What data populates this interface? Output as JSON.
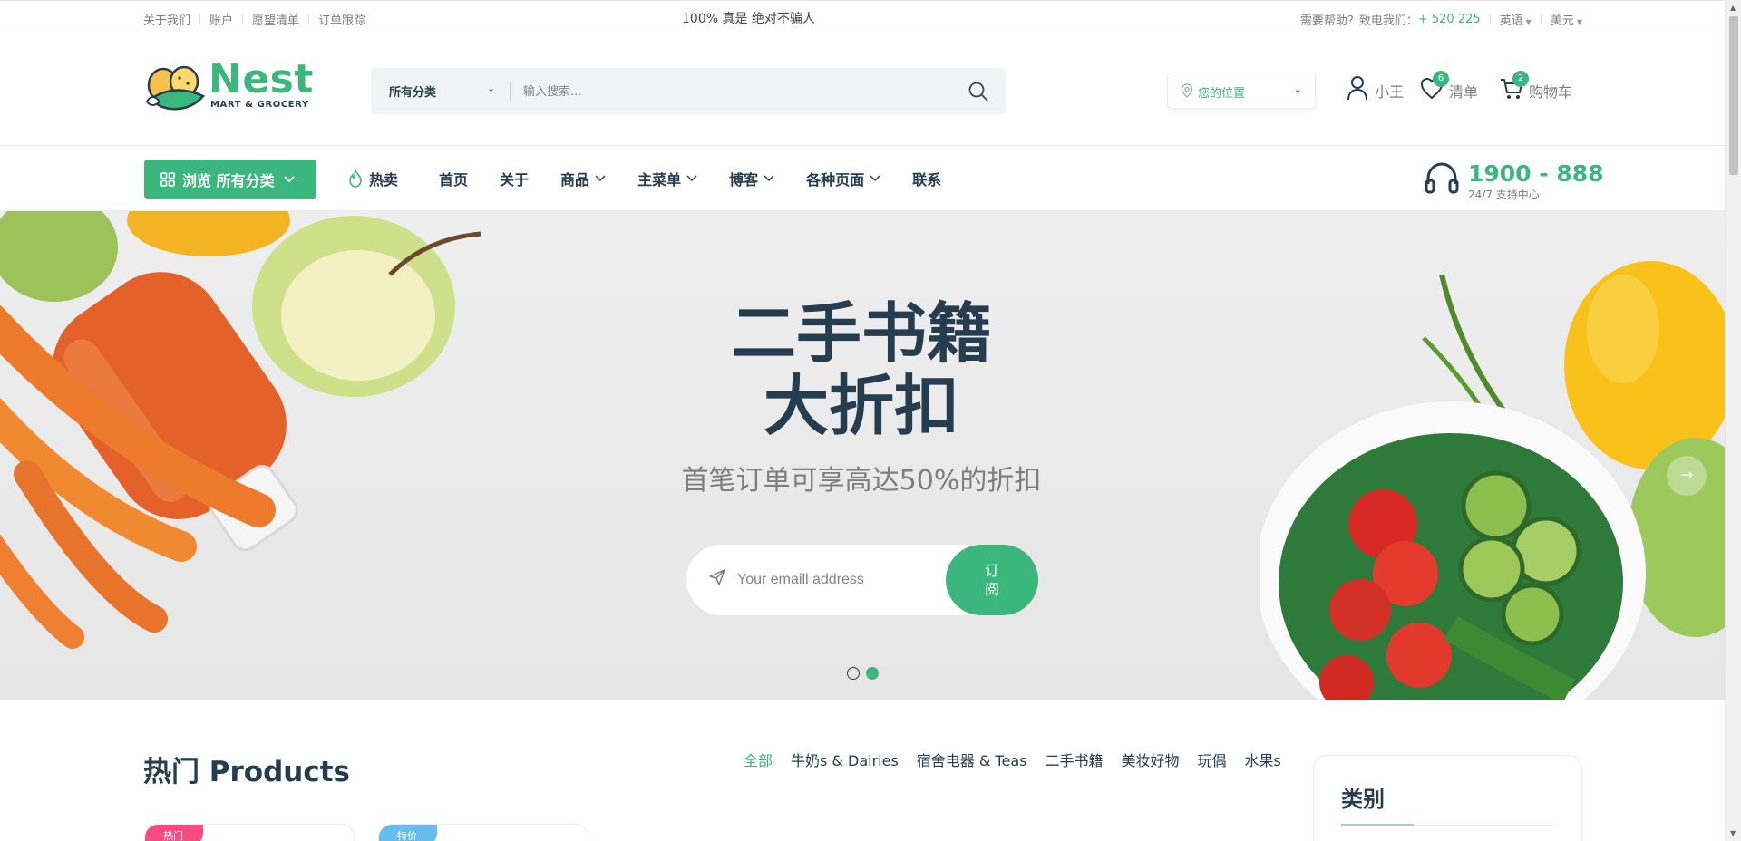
{
  "topbar": {
    "links": [
      "关于我们",
      "账户",
      "愿望清单",
      "订单跟踪"
    ],
    "center_text": "100% 真是 绝对不骗人",
    "help_prefix": "需要帮助？致电我们：",
    "help_phone": "+ 520 225",
    "language": "英语",
    "currency": "美元"
  },
  "header": {
    "brand": "Nest",
    "tagline": "MART & GROCERY",
    "search": {
      "category": "所有分类",
      "placeholder": "输入搜索..."
    },
    "location": "您的位置",
    "account_label": "小王",
    "wishlist_label": "清单",
    "wishlist_count": "6",
    "cart_label": "购物车",
    "cart_count": "2"
  },
  "nav": {
    "browse_label": "浏览 所有分类",
    "hot_label": "热卖",
    "links": [
      {
        "label": "首页",
        "dropdown": false
      },
      {
        "label": "关于",
        "dropdown": false
      },
      {
        "label": "商品",
        "dropdown": true
      },
      {
        "label": "主菜单",
        "dropdown": true
      },
      {
        "label": "博客",
        "dropdown": true
      },
      {
        "label": "各种页面",
        "dropdown": true
      },
      {
        "label": "联系",
        "dropdown": false
      }
    ],
    "hotline_number": "1900 - 888",
    "hotline_sub": "24/7 支持中心"
  },
  "hero": {
    "title_line1": "二手书籍",
    "title_line2": "大折扣",
    "subtitle": "首笔订单可享高达50%的折扣",
    "email_placeholder": "Your emaill address",
    "subscribe_line1": "订",
    "subscribe_line2": "阅",
    "active_slide": 2,
    "slide_count": 2
  },
  "products": {
    "title": "热门 Products",
    "filters": [
      "全部",
      "牛奶s & Dairies",
      "宿舍电器 & Teas",
      "二手书籍",
      "美妆好物",
      "玩偶",
      "水果s"
    ],
    "active_filter": 0,
    "cards": [
      {
        "tag": "热门",
        "tag_color": "#f74b81"
      },
      {
        "tag": "特价",
        "tag_color": "#67bcee"
      }
    ]
  },
  "sidebar": {
    "category_title": "类别"
  },
  "colors": {
    "accent": "#3bb77e",
    "heading": "#253d4e",
    "muted": "#7e7e7e"
  }
}
